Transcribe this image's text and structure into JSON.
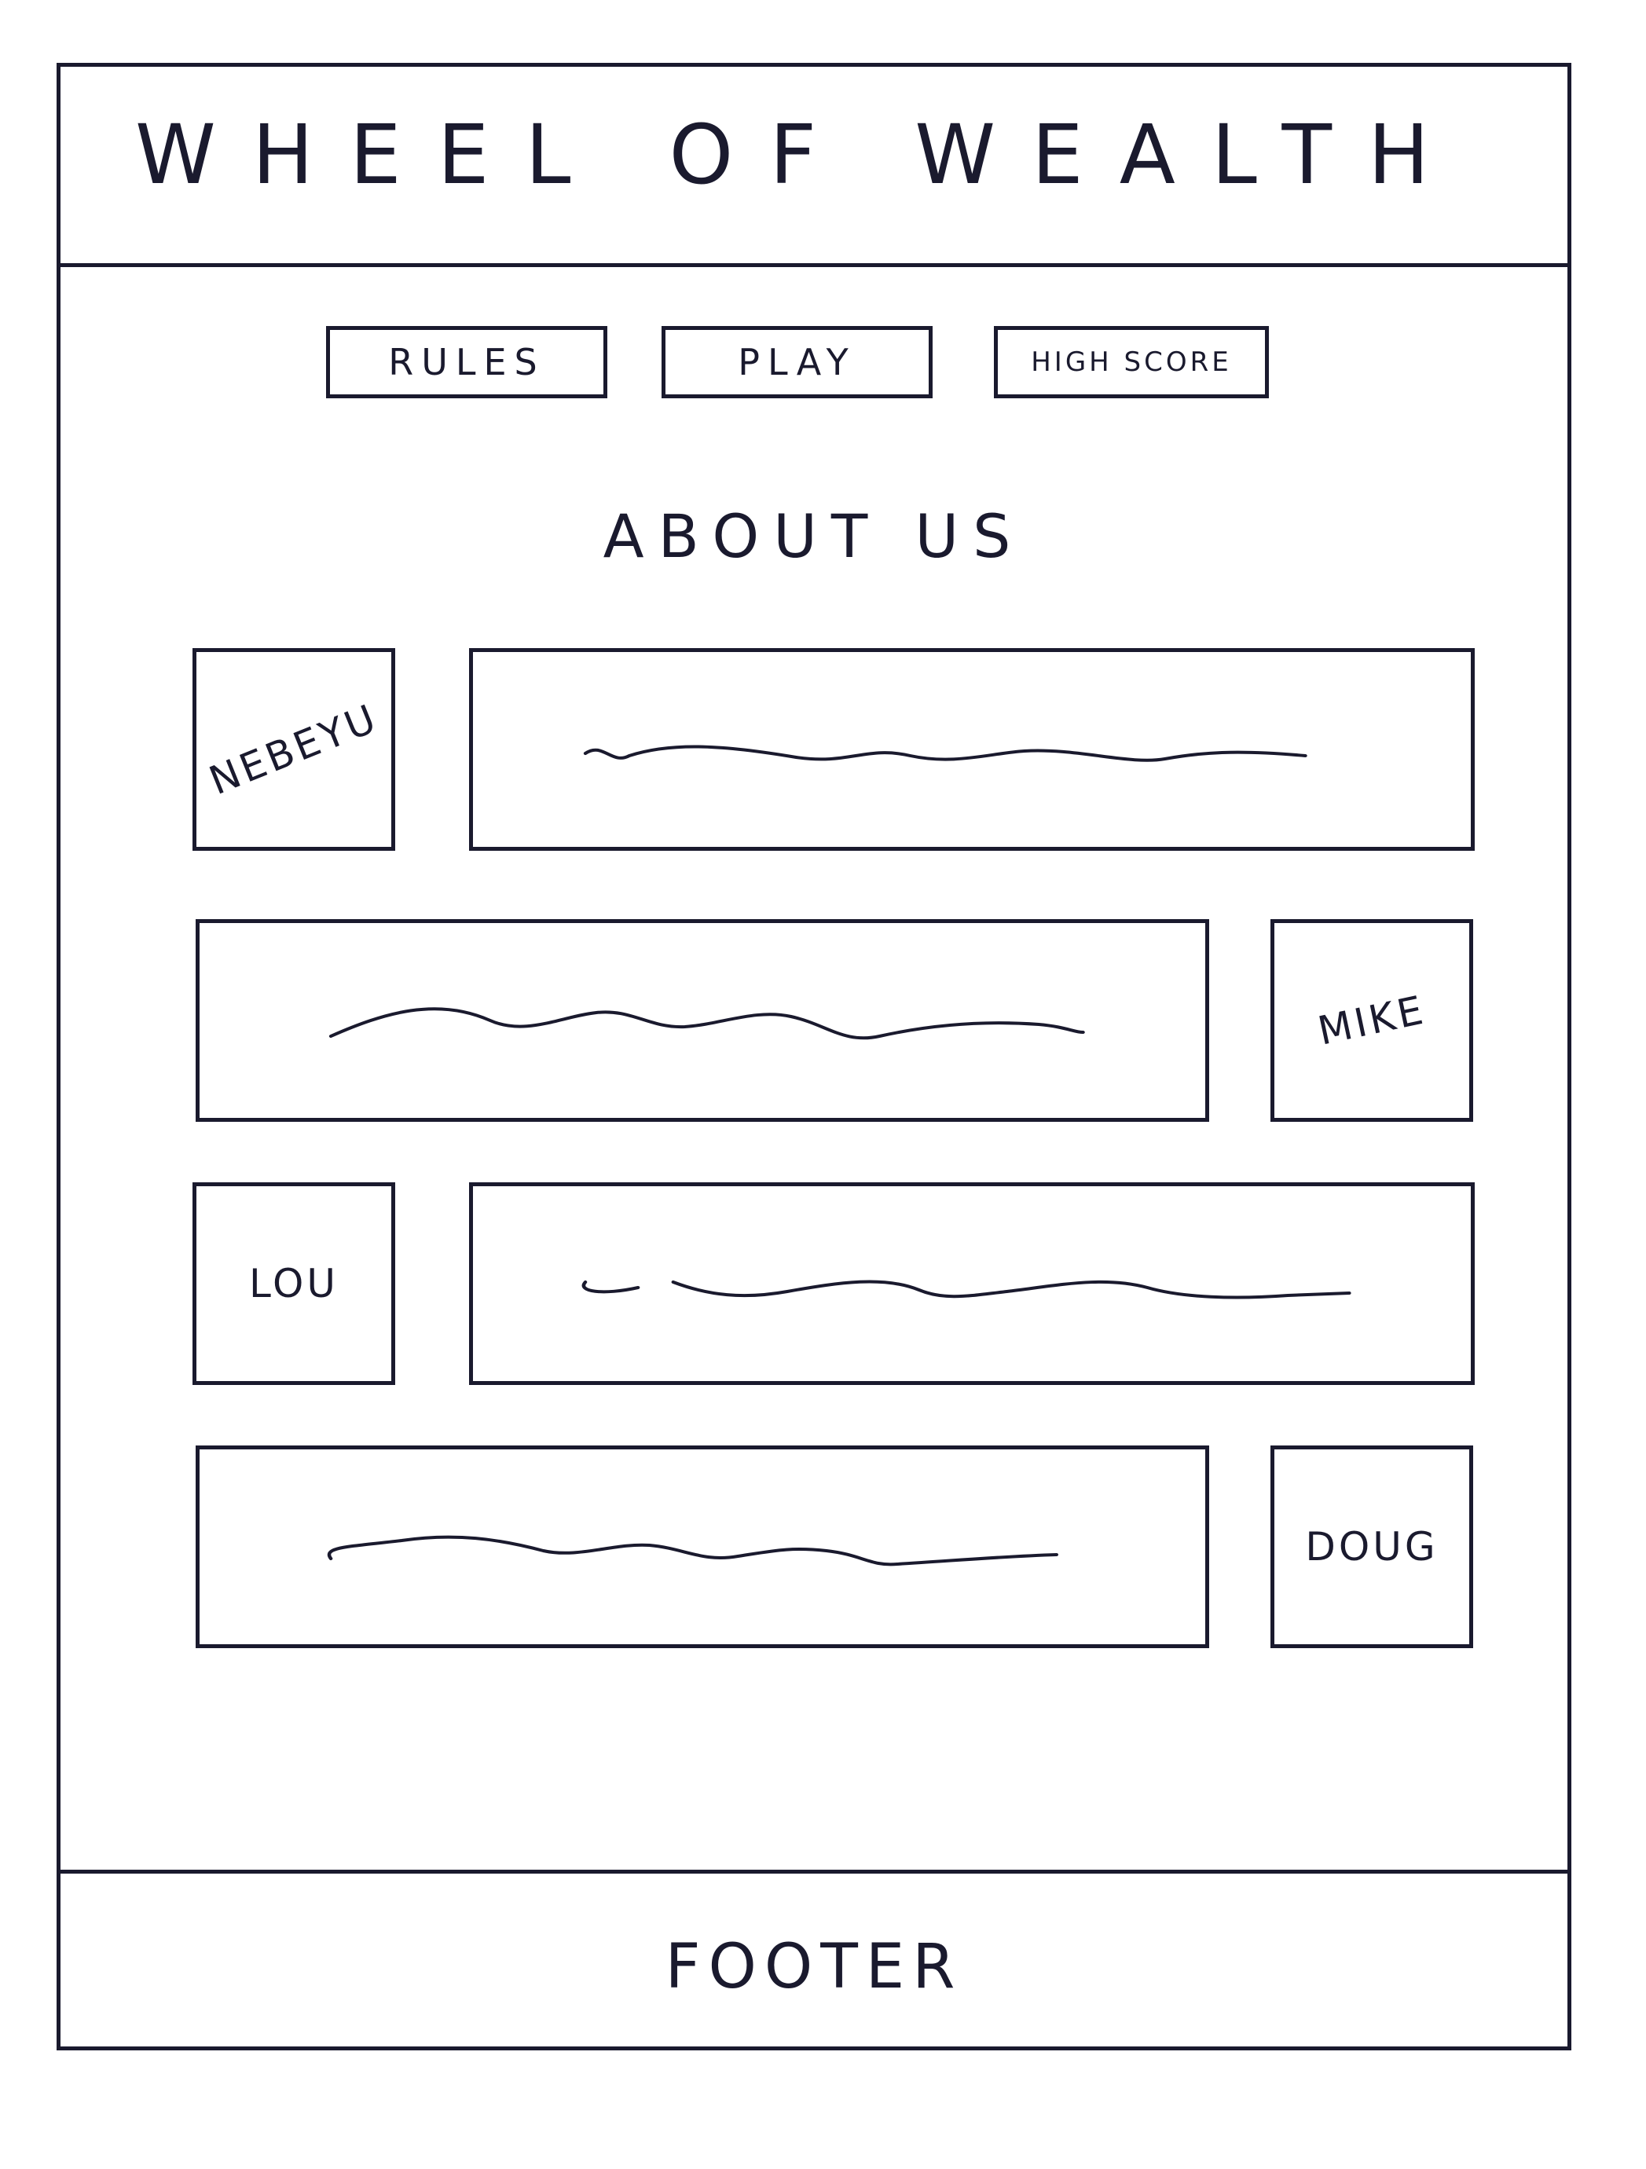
{
  "header": {
    "title": "WHEEL OF WEALTH"
  },
  "nav": {
    "rules_label": "RULES",
    "play_label": "PLAY",
    "high_score_label": "HIGH SCORE"
  },
  "main": {
    "section_title": "ABOUT US",
    "members": [
      {
        "name": "NEBEYU",
        "image_side": "left"
      },
      {
        "name": "MIKE",
        "image_side": "right"
      },
      {
        "name": "LOU",
        "image_side": "left"
      },
      {
        "name": "DOUG",
        "image_side": "right"
      }
    ]
  },
  "footer": {
    "label": "FOOTER"
  },
  "colors": {
    "ink": "#1a1a2e",
    "paper": "#ffffff"
  }
}
